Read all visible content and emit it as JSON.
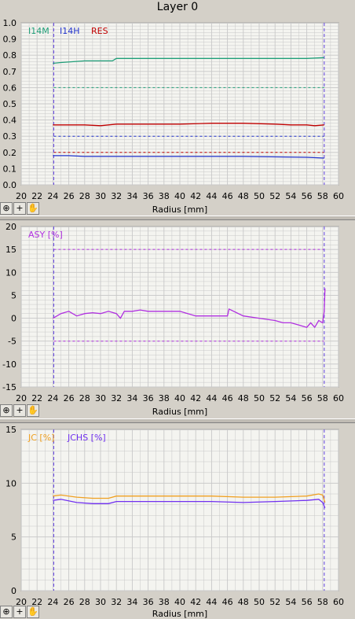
{
  "window": {
    "title": "Layer 0"
  },
  "toolbar": {
    "icons": [
      "zoom-icon",
      "crosshair-icon",
      "hand-pan-icon"
    ],
    "zoom_glyph": "⊕",
    "cross_glyph": "+",
    "hand_glyph": "✋"
  },
  "colors": {
    "I14M": "#1f9e78",
    "I14H": "#2233cc",
    "RES": "#c00000",
    "ASY": "#b030e0",
    "JC": "#f0a020",
    "JCHS": "#7030f0",
    "grid": "#c8c8c8",
    "marker": "#6040e0"
  },
  "chart_data": [
    {
      "type": "line",
      "xlabel": "Radius [mm]",
      "xlim": [
        20,
        60
      ],
      "xticks": [
        20,
        22,
        24,
        26,
        28,
        30,
        32,
        34,
        36,
        38,
        40,
        42,
        44,
        46,
        48,
        50,
        52,
        54,
        56,
        58,
        60
      ],
      "ylim": [
        0,
        1.0
      ],
      "yticks": [
        "0.0",
        "0.1",
        "0.2",
        "0.3",
        "0.4",
        "0.5",
        "0.6",
        "0.7",
        "0.8",
        "0.9",
        "1.0"
      ],
      "ytick_values": [
        0,
        0.1,
        0.2,
        0.3,
        0.4,
        0.5,
        0.6,
        0.7,
        0.8,
        0.9,
        1.0
      ],
      "markers_x": [
        24.1,
        58.2
      ],
      "legend": [
        "I14M",
        "I14H",
        "RES"
      ],
      "series": [
        {
          "name": "I14M",
          "x": [
            24,
            25,
            28,
            31.5,
            32,
            36,
            40,
            44,
            48,
            52,
            56,
            58.2
          ],
          "y": [
            0.75,
            0.755,
            0.765,
            0.765,
            0.78,
            0.78,
            0.78,
            0.78,
            0.78,
            0.78,
            0.78,
            0.785
          ]
        },
        {
          "name": "RES",
          "x": [
            24,
            26,
            28,
            30,
            32,
            36,
            40,
            44,
            48,
            52,
            54,
            56,
            57,
            58.2
          ],
          "y": [
            0.37,
            0.37,
            0.37,
            0.365,
            0.375,
            0.375,
            0.375,
            0.38,
            0.38,
            0.375,
            0.37,
            0.37,
            0.365,
            0.37
          ]
        },
        {
          "name": "I14H",
          "x": [
            24,
            26,
            28,
            32,
            40,
            48,
            56,
            58.2
          ],
          "y": [
            0.18,
            0.18,
            0.175,
            0.175,
            0.175,
            0.175,
            0.17,
            0.165
          ]
        }
      ],
      "ref_lines": [
        {
          "series": "I14M",
          "y": 0.6
        },
        {
          "series": "RES",
          "y": 0.2
        },
        {
          "series": "I14H",
          "y": 0.3
        }
      ]
    },
    {
      "type": "line",
      "xlabel": "Radius [mm]",
      "xlim": [
        20,
        60
      ],
      "xticks": [
        20,
        22,
        24,
        26,
        28,
        30,
        32,
        34,
        36,
        38,
        40,
        42,
        44,
        46,
        48,
        50,
        52,
        54,
        56,
        58,
        60
      ],
      "ylim": [
        -15,
        20
      ],
      "yticks": [
        "-15",
        "-10",
        "-5",
        "0",
        "5",
        "10",
        "15",
        "20"
      ],
      "ytick_values": [
        -15,
        -10,
        -5,
        0,
        5,
        10,
        15,
        20
      ],
      "markers_x": [
        24.1,
        58.2
      ],
      "legend": [
        "ASY [%]"
      ],
      "series": [
        {
          "name": "ASY [%]",
          "x": [
            24,
            24.5,
            25,
            26,
            27,
            28,
            29,
            30,
            31,
            32,
            32.5,
            33,
            34,
            35,
            36,
            38,
            40,
            42,
            44,
            46,
            46.2,
            48,
            50,
            52,
            53,
            54,
            55,
            56,
            56.5,
            57,
            57.5,
            58,
            58.2,
            58.3
          ],
          "y": [
            0,
            0.5,
            1.0,
            1.5,
            0.5,
            1.0,
            1.2,
            1.0,
            1.5,
            1.0,
            0.0,
            1.5,
            1.5,
            1.8,
            1.5,
            1.5,
            1.5,
            0.5,
            0.5,
            0.5,
            2.0,
            0.5,
            0.0,
            -0.5,
            -1.0,
            -1.0,
            -1.5,
            -2.0,
            -1.0,
            -2.0,
            -0.5,
            -1.0,
            1.5,
            6.5
          ]
        }
      ],
      "ref_lines": [
        {
          "series": "ASY [%]",
          "y": 15
        },
        {
          "series": "ASY [%]",
          "y": -5
        }
      ]
    },
    {
      "type": "line",
      "xlabel": "Radius [mm]",
      "xlim": [
        20,
        60
      ],
      "xticks": [
        20,
        22,
        24,
        26,
        28,
        30,
        32,
        34,
        36,
        38,
        40,
        42,
        44,
        46,
        48,
        50,
        52,
        54,
        56,
        58,
        60
      ],
      "ylim": [
        0,
        15
      ],
      "yticks": [
        "0",
        "5",
        "10",
        "15"
      ],
      "ytick_values": [
        0,
        5,
        10,
        15
      ],
      "markers_x": [
        24.1,
        58.2
      ],
      "legend": [
        "JC [%]",
        "JCHS [%]"
      ],
      "series": [
        {
          "name": "JC [%]",
          "x": [
            24,
            25,
            27,
            29,
            31,
            32,
            36,
            40,
            44,
            48,
            52,
            56,
            57.5,
            58,
            58.3
          ],
          "y": [
            8.8,
            8.9,
            8.7,
            8.6,
            8.6,
            8.8,
            8.8,
            8.8,
            8.8,
            8.7,
            8.7,
            8.8,
            9.0,
            8.9,
            8.2
          ]
        },
        {
          "name": "JCHS [%]",
          "x": [
            24,
            25,
            27,
            29,
            31,
            32,
            36,
            40,
            44,
            48,
            52,
            56,
            57.5,
            58,
            58.3
          ],
          "y": [
            8.4,
            8.5,
            8.2,
            8.1,
            8.1,
            8.3,
            8.3,
            8.3,
            8.3,
            8.2,
            8.3,
            8.4,
            8.5,
            8.2,
            7.7
          ]
        }
      ],
      "ref_lines": []
    }
  ]
}
